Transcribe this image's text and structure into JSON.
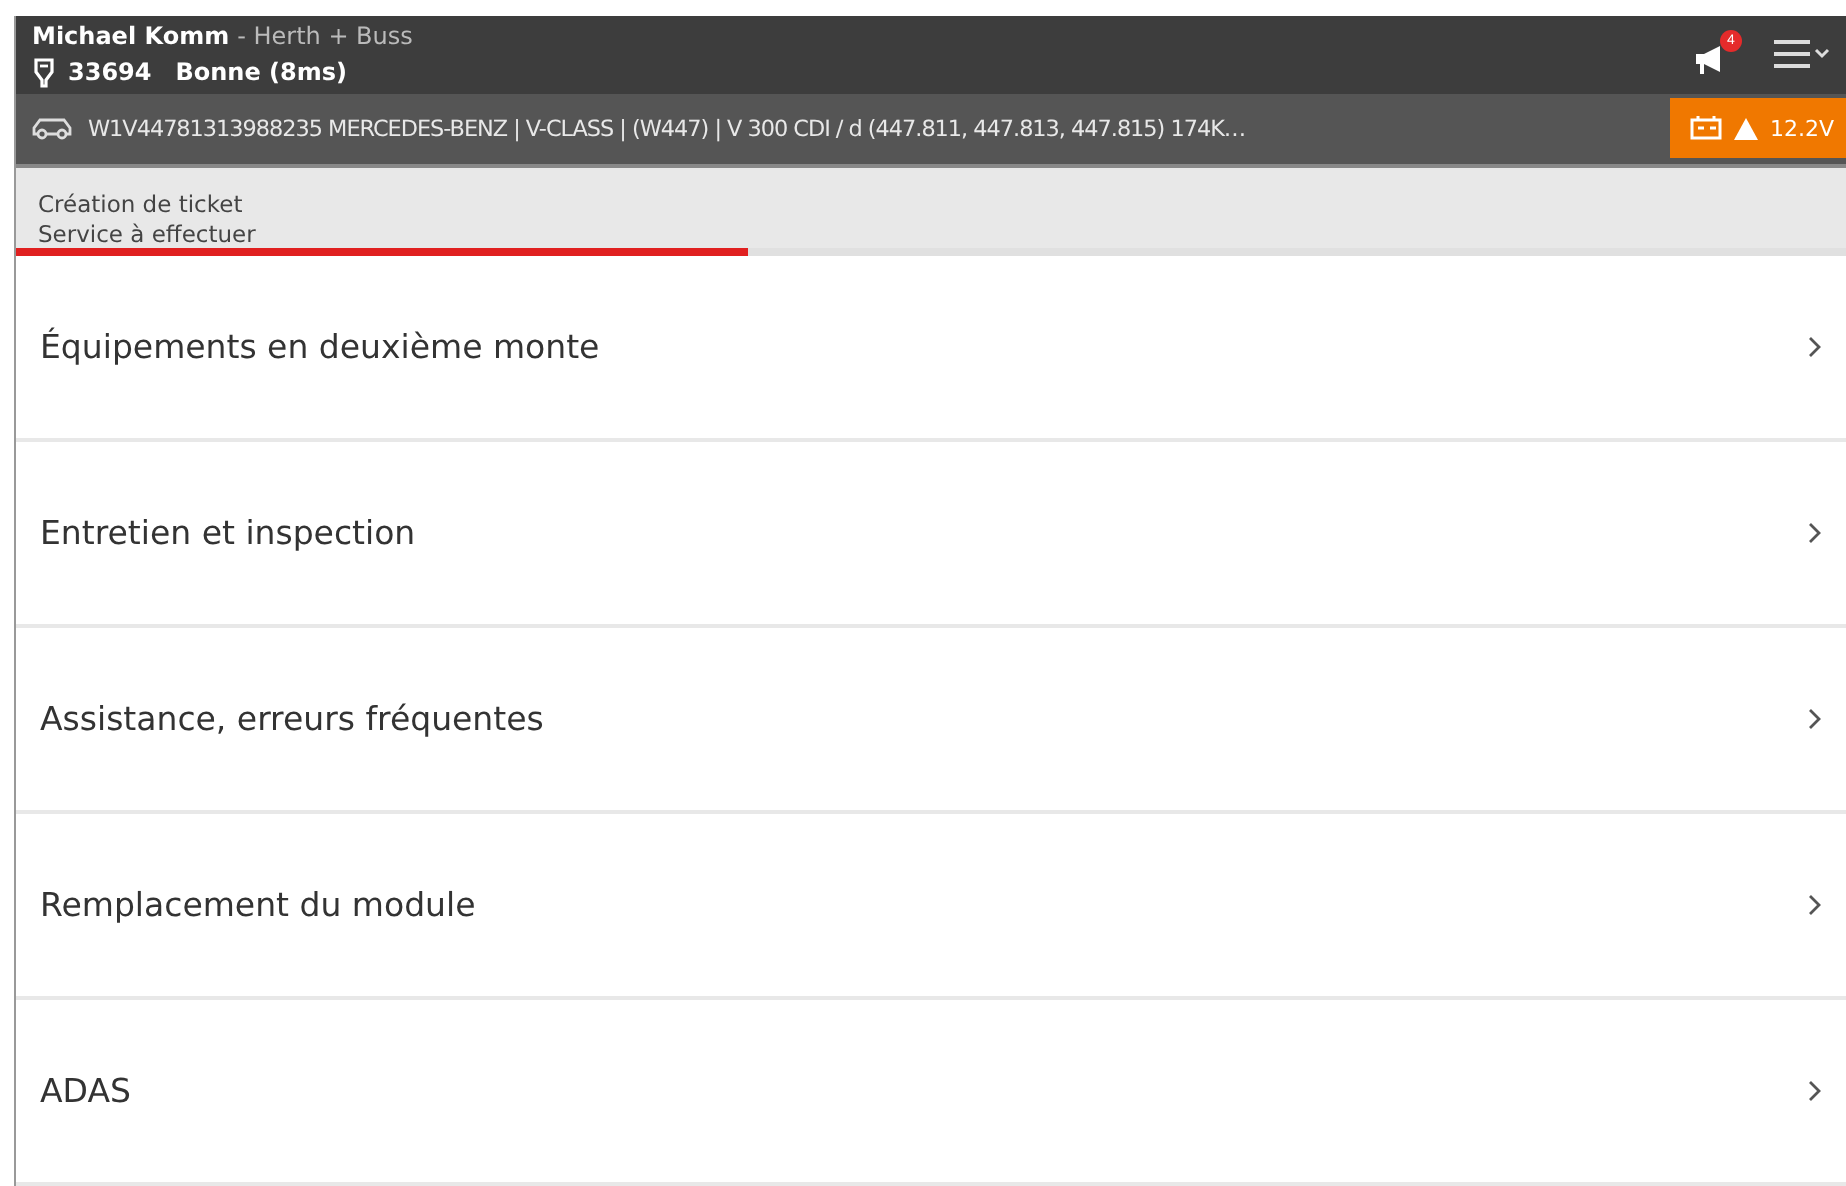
{
  "header": {
    "user": "Michael Komm",
    "company": "- Herth + Buss",
    "code": "33694",
    "connection": "Bonne (8ms)",
    "notifications": "4"
  },
  "vehicle": {
    "description": "W1V44781313988235  MERCEDES-BENZ | V-CLASS | (W447) | V 300 CDI / d (447.811, 447.813, 447.815) 174K…",
    "voltage": "12.2V"
  },
  "breadcrumb": {
    "title": "Création de ticket",
    "subtitle": "Service à effectuer",
    "level": 0.4
  },
  "items": [
    {
      "label": "Équipements en deuxième monte"
    },
    {
      "label": "Entretien et inspection"
    },
    {
      "label": "Assistance, erreurs fréquentes"
    },
    {
      "label": "Remplacement du module"
    },
    {
      "label": "ADAS"
    }
  ]
}
